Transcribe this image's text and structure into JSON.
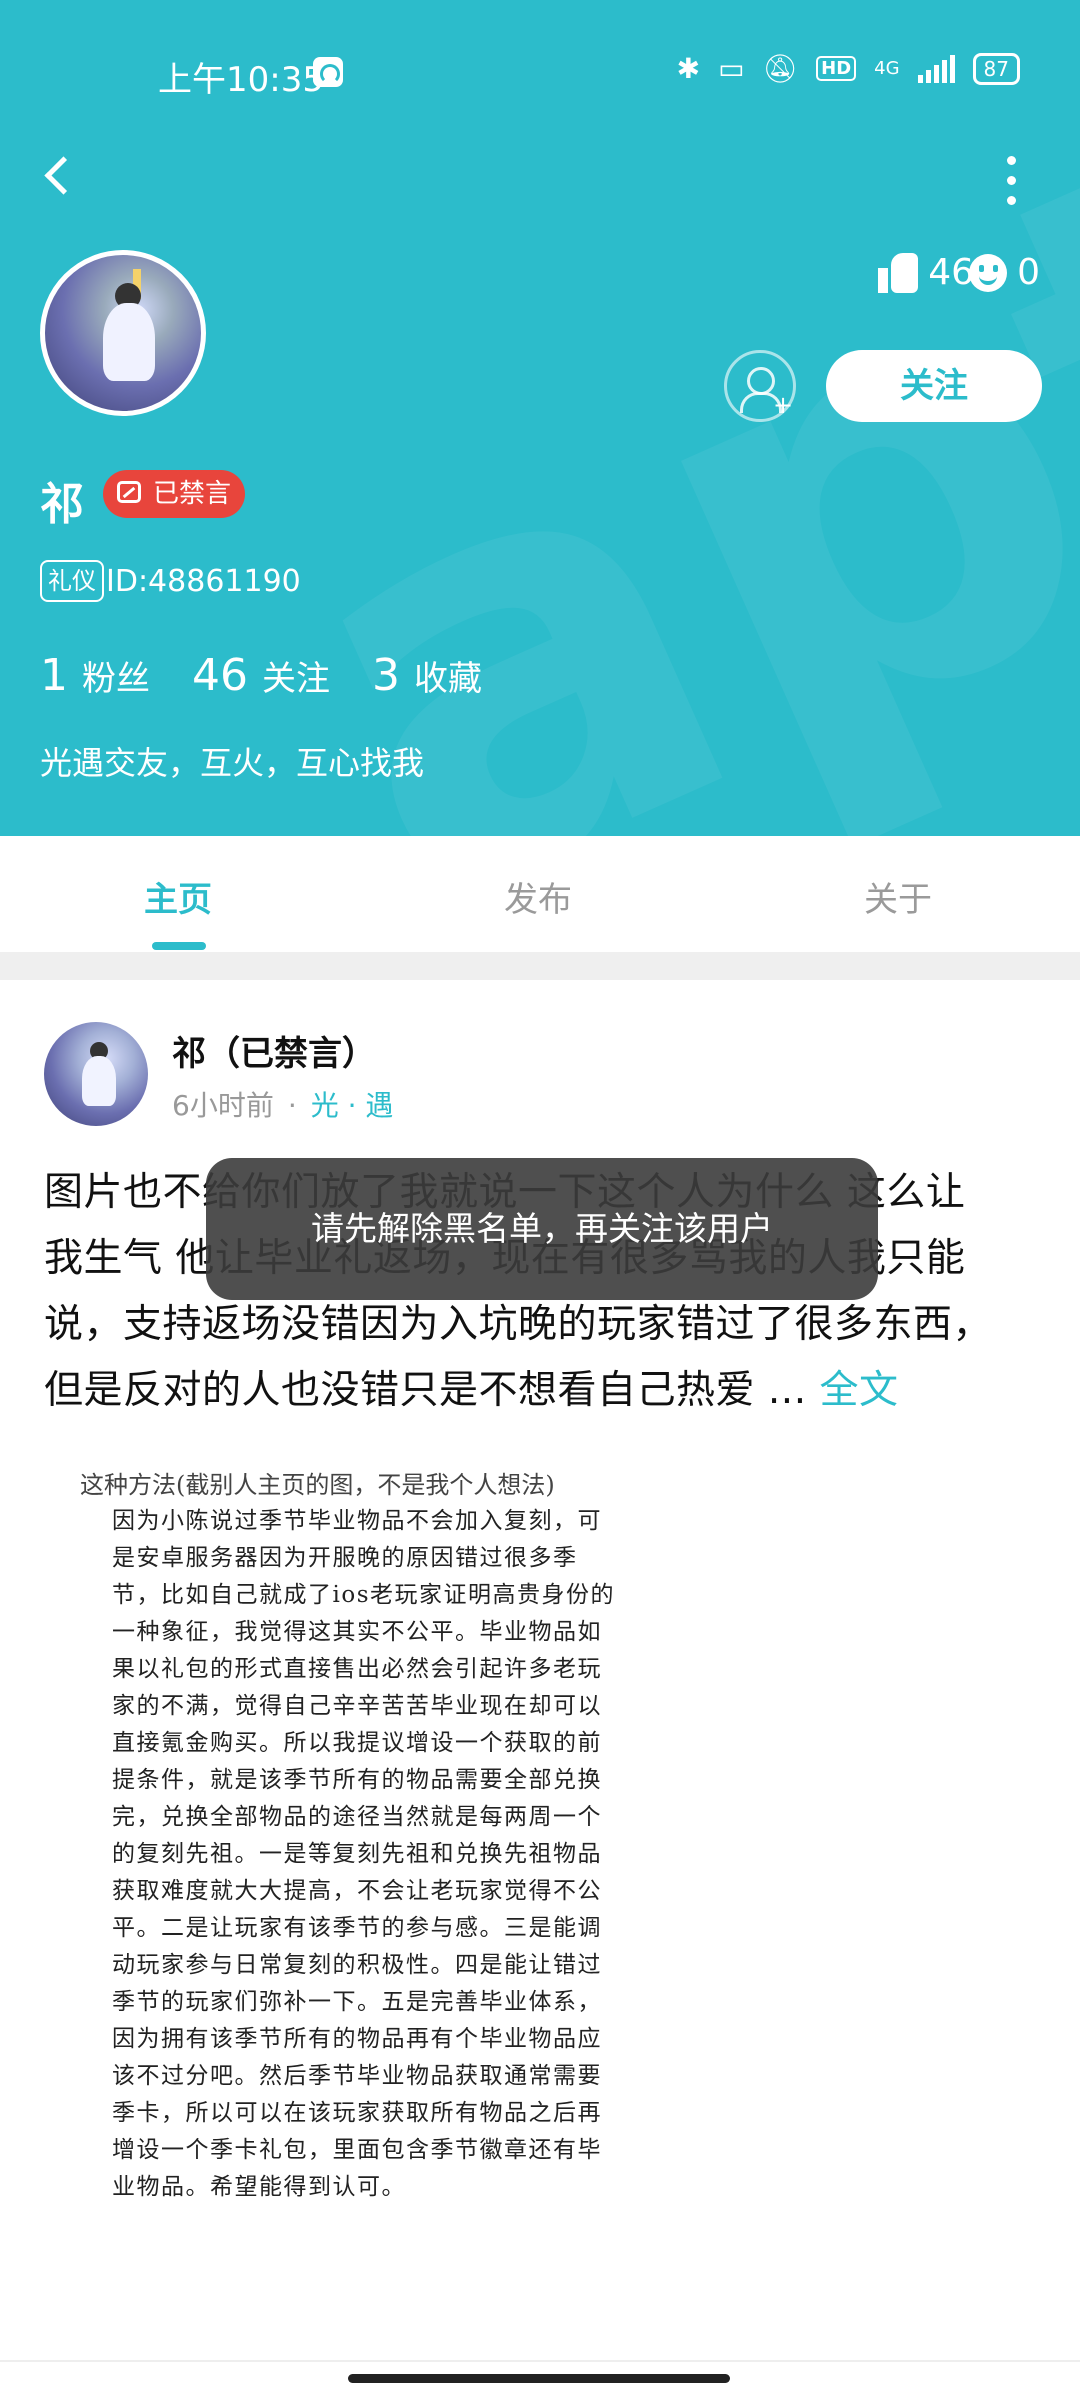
{
  "status_bar": {
    "time": "上午10:35",
    "network": "4G",
    "hd": "HD",
    "battery": "87"
  },
  "profile": {
    "name": "祁",
    "ban_label": "已禁言",
    "role_tag": "礼仪",
    "id_text": "ID:48861190",
    "likes": "46",
    "reactions": "0",
    "follow_label": "关注",
    "stats": [
      {
        "num": "1",
        "label": "粉丝"
      },
      {
        "num": "46",
        "label": "关注"
      },
      {
        "num": "3",
        "label": "收藏"
      }
    ],
    "bio": "光遇交友，互火，互心找我"
  },
  "tabs": [
    {
      "label": "主页",
      "active": true
    },
    {
      "label": "发布",
      "active": false
    },
    {
      "label": "关于",
      "active": false
    }
  ],
  "post": {
    "author": "祁（已禁言）",
    "time": "6小时前",
    "dot": "·",
    "topic": "光 · 遇",
    "body_lines": [
      "图片也不给你们放了我就说一下这个人为什么 这么让",
      "我生气 他让毕业礼返场，现在有很多骂我的人我只能",
      "说，支持返场没错因为入坑晚的玩家错过了很多东西，",
      "但是反对的人也没错只是不想看自己热爱 ... "
    ],
    "more_label": "全文",
    "image_title": "这种方法(截别人主页的图，不是我个人想法)",
    "image_lines": [
      "因为小陈说过季节毕业物品不会加入复刻，可",
      "是安卓服务器因为开服晚的原因错过很多季",
      "节，比如自己就成了ios老玩家证明高贵身份的",
      "一种象征，我觉得这其实不公平。毕业物品如",
      "果以礼包的形式直接售出必然会引起许多老玩",
      "家的不满，觉得自己辛辛苦苦毕业现在却可以",
      "直接氪金购买。所以我提议增设一个获取的前",
      "提条件，就是该季节所有的物品需要全部兑换",
      "完，兑换全部物品的途径当然就是每两周一个",
      "的复刻先祖。一是等复刻先祖和兑换先祖物品",
      "获取难度就大大提高，不会让老玩家觉得不公",
      "平。二是让玩家有该季节的参与感。三是能调",
      "动玩家参与日常复刻的积极性。四是能让错过",
      "季节的玩家们弥补一下。五是完善毕业体系，",
      "因为拥有该季节所有的物品再有个毕业物品应",
      "该不过分吧。然后季节毕业物品获取通常需要",
      "季卡，所以可以在该玩家获取所有物品之后再",
      "增设一个季卡礼包，里面包含季节徽章还有毕",
      "业物品。希望能得到认可。"
    ]
  },
  "toast": "请先解除黑名单，再关注该用户",
  "colors": {
    "accent": "#2cbccb",
    "ban_badge": "#e8453c"
  }
}
